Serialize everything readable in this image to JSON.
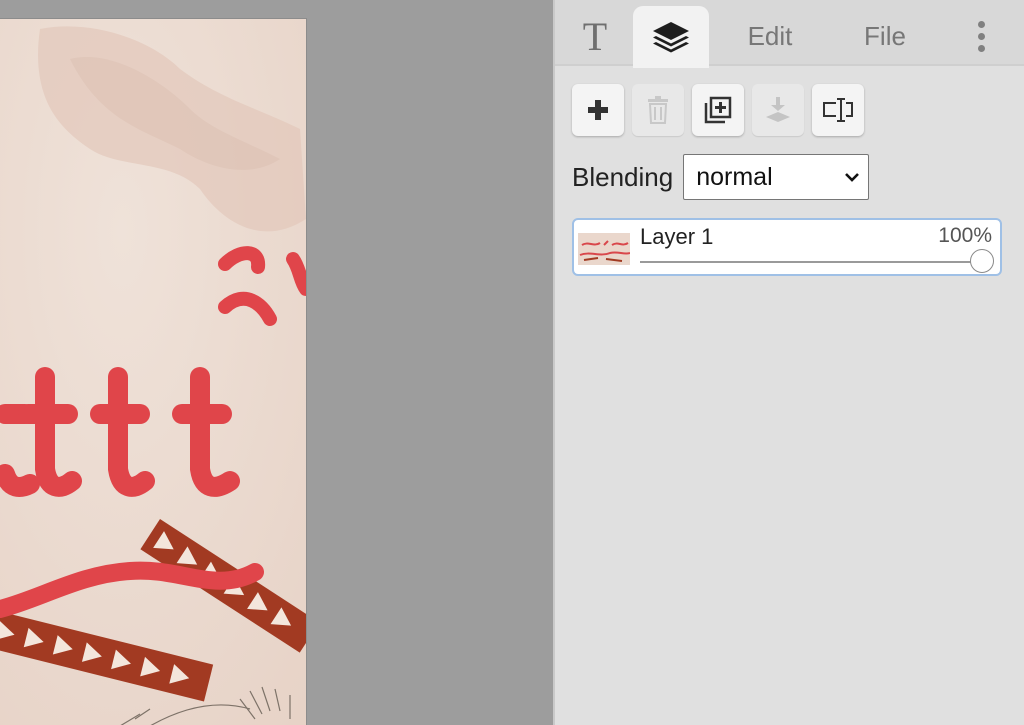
{
  "canvas": {
    "artwork_text": "tttt"
  },
  "panel": {
    "tabs": [
      {
        "id": "text",
        "icon": "text-icon",
        "label": "T"
      },
      {
        "id": "layers",
        "icon": "layers-icon",
        "active": true
      },
      {
        "id": "edit",
        "label": "Edit"
      },
      {
        "id": "file",
        "label": "File"
      },
      {
        "id": "more",
        "icon": "more-vertical-icon"
      }
    ],
    "toolbar": {
      "buttons": [
        {
          "icon": "plus-icon",
          "enabled": true
        },
        {
          "icon": "trash-icon",
          "enabled": false
        },
        {
          "icon": "duplicate-layer-icon",
          "enabled": true
        },
        {
          "icon": "merge-down-icon",
          "enabled": false
        },
        {
          "icon": "rename-layer-icon",
          "enabled": true
        }
      ]
    },
    "blending": {
      "label": "Blending",
      "value": "normal"
    },
    "layers": [
      {
        "name": "Layer 1",
        "opacity": "100%",
        "opacity_value": 1.0,
        "selected": true
      }
    ]
  },
  "colors": {
    "accent_red": "#e0454a",
    "stripe_brown": "#a23a22",
    "selection_border": "#9fc0e6"
  }
}
